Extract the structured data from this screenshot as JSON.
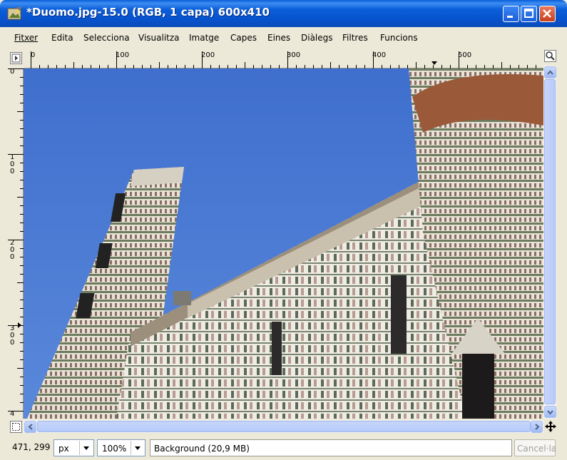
{
  "window": {
    "title": "*Duomo.jpg-15.0 (RGB, 1 capa) 600x410"
  },
  "menu": {
    "items": [
      "Fitxer",
      "Edita",
      "Selecciona",
      "Visualitza",
      "Imatge",
      "Capes",
      "Eines",
      "Diàlegs",
      "Filtres",
      "Funcions"
    ]
  },
  "rulers": {
    "horizontal_labels": [
      "0",
      "100",
      "200",
      "300",
      "400",
      "500"
    ],
    "vertical_labels": [
      "0",
      "1\n0\n0",
      "2\n0\n0",
      "3\n0\n0",
      "4"
    ]
  },
  "canvas": {
    "image_description_icon": "image-canvas"
  },
  "status": {
    "coordinates": "471, 299",
    "unit": "px",
    "zoom": "100%",
    "message": "Background (20,9 MB)",
    "cancel_label": "Cancel·la"
  },
  "colors": {
    "titlebar": "#0b5ed9",
    "sky": "#3f6fce",
    "window_bg": "#ece9d8"
  }
}
